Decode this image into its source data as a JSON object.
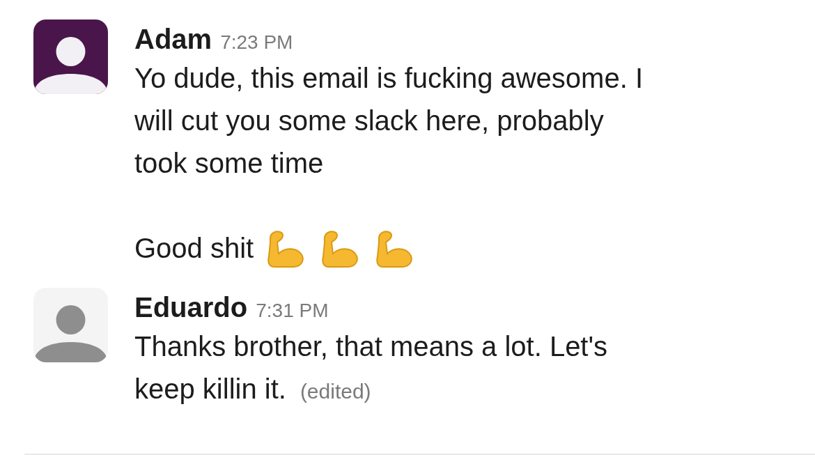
{
  "messages": [
    {
      "author": "Adam",
      "time": "7:23 PM",
      "avatar": {
        "kind": "dark",
        "color": "#4a154b"
      },
      "paragraphs": [
        {
          "text": "Yo dude, this email is fucking awesome. I will cut you some slack here, probably took some time"
        },
        {
          "text": "Good shit",
          "icons": [
            {
              "kind": "flexed-arm"
            },
            {
              "kind": "flexed-arm"
            },
            {
              "kind": "flexed-arm"
            }
          ]
        }
      ]
    },
    {
      "author": "Eduardo",
      "time": "7:31 PM",
      "avatar": {
        "kind": "light",
        "color": "#f4f4f4"
      },
      "paragraphs": [
        {
          "text": "Thanks brother, that means a lot. Let's keep killin it.",
          "edited_label": "(edited)"
        }
      ]
    }
  ]
}
